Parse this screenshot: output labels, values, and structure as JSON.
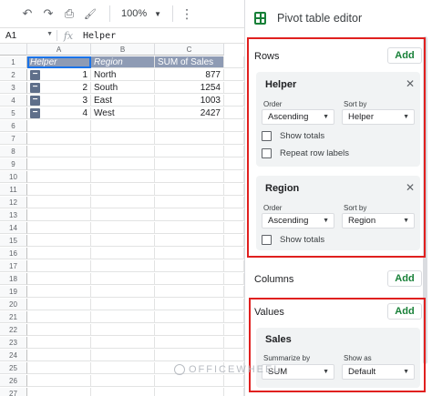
{
  "toolbar": {
    "undo_icon": "↶",
    "redo_icon": "↷",
    "print_icon": "⎙",
    "paint_icon": "🖌",
    "zoom": "100%",
    "more_icon": "⋮"
  },
  "formula_bar": {
    "cell_ref": "A1",
    "fx": "fx",
    "content": "Helper"
  },
  "grid": {
    "columns": [
      "A",
      "B",
      "C"
    ],
    "rows": [
      "1",
      "2",
      "3",
      "4",
      "5",
      "6",
      "7",
      "8",
      "9",
      "10",
      "11",
      "12",
      "13",
      "14",
      "15",
      "16",
      "17",
      "18",
      "19",
      "20",
      "21",
      "22",
      "23",
      "24",
      "25",
      "26",
      "27",
      "28"
    ],
    "header": {
      "a": "Helper",
      "b": "Region",
      "c": "SUM of Sales"
    },
    "data": [
      {
        "helper": "1",
        "region": "North",
        "sales": "877"
      },
      {
        "helper": "2",
        "region": "South",
        "sales": "1254"
      },
      {
        "helper": "3",
        "region": "East",
        "sales": "1003"
      },
      {
        "helper": "4",
        "region": "West",
        "sales": "2427"
      }
    ]
  },
  "panel": {
    "title": "Pivot table editor",
    "rows_label": "Rows",
    "add_label": "Add",
    "close_icon": "✕",
    "caret_icon": "▼",
    "helper_card": {
      "title": "Helper",
      "order_label": "Order",
      "order_value": "Ascending",
      "sortby_label": "Sort by",
      "sortby_value": "Helper",
      "show_totals": "Show totals",
      "repeat_labels": "Repeat row labels"
    },
    "region_card": {
      "title": "Region",
      "order_label": "Order",
      "order_value": "Ascending",
      "sortby_label": "Sort by",
      "sortby_value": "Region",
      "show_totals": "Show totals"
    },
    "columns_label": "Columns",
    "values_label": "Values",
    "sales_card": {
      "title": "Sales",
      "summarize_label": "Summarize by",
      "summarize_value": "SUM",
      "showas_label": "Show as",
      "showas_value": "Default"
    }
  },
  "watermark": "OFFICEWHEEL",
  "colors": {
    "accent_green": "#188038",
    "header_fill": "#8e9bb4",
    "highlight_red": "#e0201f",
    "selection_blue": "#1a73e8"
  }
}
